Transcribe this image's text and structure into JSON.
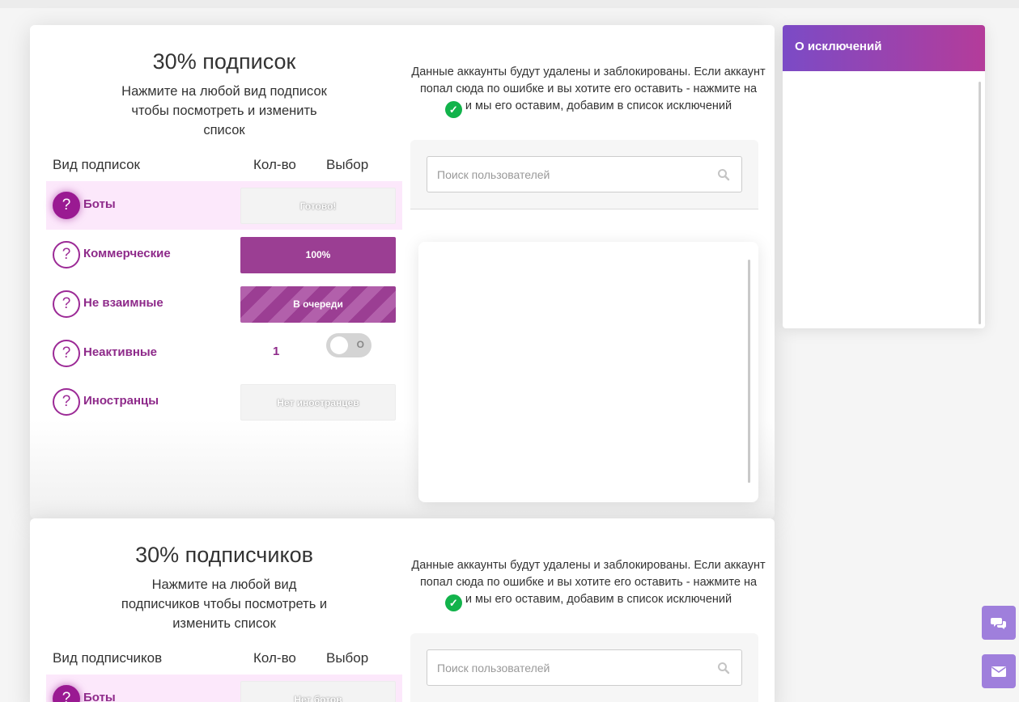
{
  "colors": {
    "accent": "#9b3e93",
    "brand_gradient": [
      "#7b4bc6",
      "#b43c9a"
    ],
    "check": "#12b34b",
    "active_row": "#fce8fb"
  },
  "section1": {
    "title": "30% подписок",
    "subtitle": "Нажмите на любой вид подписок чтобы посмотреть и изменить список",
    "headers": {
      "type": "Вид подписок",
      "count": "Кол-во",
      "choice": "Выбор"
    },
    "rows": [
      {
        "label": "Боты",
        "button": "Готово!",
        "style": "grey",
        "icon": "question-icon"
      },
      {
        "label": "Коммерческие",
        "button": "100%",
        "style": "purple",
        "icon": "question-icon"
      },
      {
        "label": "Не взаимные",
        "button": "В очереди",
        "style": "striped",
        "icon": "question-icon"
      },
      {
        "label": "Неактивные",
        "count": "1",
        "toggle_label": "O",
        "icon": "question-icon"
      },
      {
        "label": "Иностранцы",
        "button": "Нет иностранцев",
        "style": "grey",
        "icon": "question-icon"
      }
    ],
    "info_before": "Данные аккаунты будут удалены и заблокированы. Если аккаунт попал сюда по ошибке и вы хотите его оставить - нажмите на",
    "info_after": "и мы его оставим, добавим в список исключений",
    "check_icon": "check-circle-icon",
    "search_placeholder": "Поиск пользователей"
  },
  "section2": {
    "title": "30% подписчиков",
    "subtitle": "Нажмите на любой вид подписчиков чтобы посмотреть и изменить список",
    "headers": {
      "type": "Вид подписчиков",
      "count": "Кол-во",
      "choice": "Выбор"
    },
    "rows": [
      {
        "label": "Боты",
        "button": "Нет ботов",
        "style": "grey",
        "icon": "question-icon"
      }
    ],
    "info_before": "Данные аккаунты будут удалены и заблокированы. Если аккаунт попал сюда по ошибке и вы хотите его оставить - нажмите на",
    "info_after": "и мы его оставим, добавим в список исключений",
    "search_placeholder": "Поиск пользователей"
  },
  "exceptions": {
    "title": "О исключений"
  },
  "fabs": {
    "chat_icon": "chat-icon",
    "mail_icon": "envelope-icon"
  }
}
